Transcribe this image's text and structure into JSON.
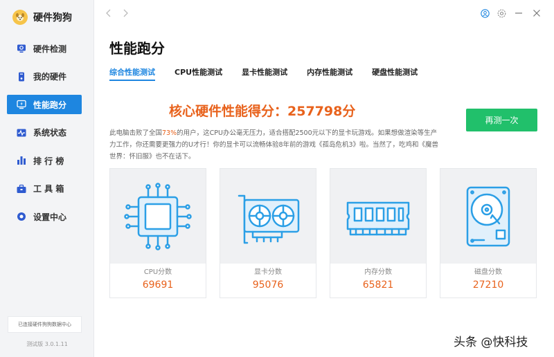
{
  "app": {
    "name": "硬件狗狗",
    "db_status": "已连接硬件狗狗数据中心",
    "version": "测试版 3.0.1.11"
  },
  "sidebar": {
    "items": [
      {
        "label": "硬件检测",
        "icon": "monitor-icon",
        "active": false
      },
      {
        "label": "我的硬件",
        "icon": "tower-icon",
        "active": false
      },
      {
        "label": "性能跑分",
        "icon": "benchmark-icon",
        "active": true
      },
      {
        "label": "系统状态",
        "icon": "pulse-icon",
        "active": false
      },
      {
        "label": "排 行 榜",
        "icon": "bar-chart-icon",
        "active": false
      },
      {
        "label": "工 具 箱",
        "icon": "toolbox-icon",
        "active": false
      },
      {
        "label": "设置中心",
        "icon": "settings-icon",
        "active": false
      }
    ]
  },
  "topbar": {
    "back": "‹",
    "forward": "›",
    "icons": [
      "user-icon",
      "gear-icon",
      "minimize-icon",
      "close-icon"
    ]
  },
  "main": {
    "title": "性能跑分",
    "tabs": [
      {
        "label": "综合性能测试",
        "active": true
      },
      {
        "label": "CPU性能测试",
        "active": false
      },
      {
        "label": "显卡性能测试",
        "active": false
      },
      {
        "label": "内存性能测试",
        "active": false
      },
      {
        "label": "硬盘性能测试",
        "active": false
      }
    ],
    "score_title": "核心硬件性能得分：257798分",
    "retest_label": "再测一次",
    "desc_prefix": "此电脑击败了全国",
    "desc_pct": "73%",
    "desc_suffix": "的用户，这CPU办公毫无压力，适合搭配2500元以下的显卡玩游戏。如果想做渲染等生产力工作，你还需要更强力的U才行！你的显卡可以流畅体验8年前的游戏《孤岛危机3》啦。当然了，吃鸡和《魔兽世界：怀旧服》也不在话下。",
    "cards": [
      {
        "label": "CPU分数",
        "value": "69691",
        "icon": "cpu-icon"
      },
      {
        "label": "显卡分数",
        "value": "95076",
        "icon": "gpu-icon"
      },
      {
        "label": "内存分数",
        "value": "65821",
        "icon": "ram-icon"
      },
      {
        "label": "磁盘分数",
        "value": "27210",
        "icon": "hdd-icon"
      }
    ]
  },
  "watermark": "头条 @快科技",
  "colors": {
    "accent": "#1e86e0",
    "score": "#e8621c",
    "button": "#21c06b",
    "icon_blue": "#2b9fe6"
  }
}
